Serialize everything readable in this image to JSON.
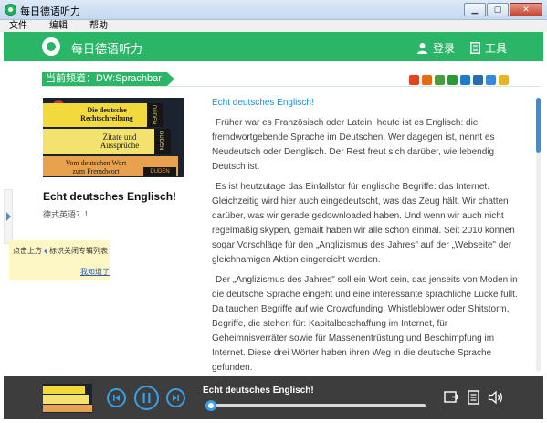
{
  "window": {
    "title": "每日德语听力"
  },
  "menu": {
    "items": [
      "文件",
      "编辑",
      "帮助"
    ]
  },
  "header": {
    "brand": "每日德语听力",
    "login_label": "登录",
    "tools_label": "工具"
  },
  "channel": {
    "label": "当前频道：DW:Sprachbar"
  },
  "share_icons": [
    {
      "name": "qzone-share-icon",
      "color": "#e4441f"
    },
    {
      "name": "weibo-share-icon",
      "color": "#e36c1b"
    },
    {
      "name": "renren-share-icon",
      "color": "#4d9a3f"
    },
    {
      "name": "douban-share-icon",
      "color": "#2e963d"
    },
    {
      "name": "kaixin-share-icon",
      "color": "#1f7cc8"
    },
    {
      "name": "tencent-share-icon",
      "color": "#2b6ab0"
    },
    {
      "name": "qq-share-icon",
      "color": "#3a89d8"
    },
    {
      "name": "favorite-share-icon",
      "color": "#e7b425"
    }
  ],
  "cover": {
    "book1_line1": "Die deutsche",
    "book1_line2": "Rechtschreibung",
    "book2_line1": "Zitate und",
    "book2_line2": "Aussprüche",
    "book3_line1": "Vom deutschen Wort",
    "book3_line2": "zum Fremdwort",
    "spine1": "DUDEN",
    "spine2": "DUDEN",
    "spine3": "DUDEN"
  },
  "left_panel": {
    "heading": "Echt deutsches Englisch!",
    "subtitle": "德式英语？！"
  },
  "tooltip": {
    "text_before": "点击上方",
    "text_after": "标识关闭专辑列表",
    "link": "我知道了"
  },
  "article": {
    "title": "Echt deutsches Englisch!",
    "paragraphs": [
      "Früher war es Französisch oder Latein, heute ist es Englisch: die fremdwortgebende Sprache im Deutschen. Wer dagegen ist, nennt es Neudeutsch oder Denglisch. Der Rest freut sich darüber, wie lebendig Deutsch ist.",
      "Es ist heutzutage das Einfallstor für englische Begriffe: das Internet. Gleichzeitig wird hier auch eingedeutscht, was das Zeug hält. Wir chatten darüber, was wir gerade gedownloaded haben. Und wenn wir auch nicht regelmäßig skypen, gemailt haben wir alle schon einmal. Seit 2010 können sogar Vorschläge für den „Anglizismus des Jahres\" auf der „Webseite\" der gleichnamigen Aktion eingereicht werden.",
      "Der „Anglizismus des Jahres\" soll ein Wort sein, das jenseits von Moden in die deutsche Sprache eingeht und eine interessante sprachliche Lücke füllt. Da tauchen Begriffe auf wie Crowdfunding, Whistleblower oder Shitstorm, Begriffe, die stehen für: Kapitalbeschaffung im Internet, für Geheimnisverräter sowie für Massenentrüstung und Beschimpfung im Internet. Diese drei Wörter haben ihren Weg in die deutsche Sprache gefunden."
    ]
  },
  "player": {
    "now_playing": "Echt deutsches Englisch!",
    "progress": 0.02
  },
  "colors": {
    "accent_green": "#2bb566",
    "accent_blue": "#39a0e8",
    "player_bg": "#3d3d3d"
  }
}
